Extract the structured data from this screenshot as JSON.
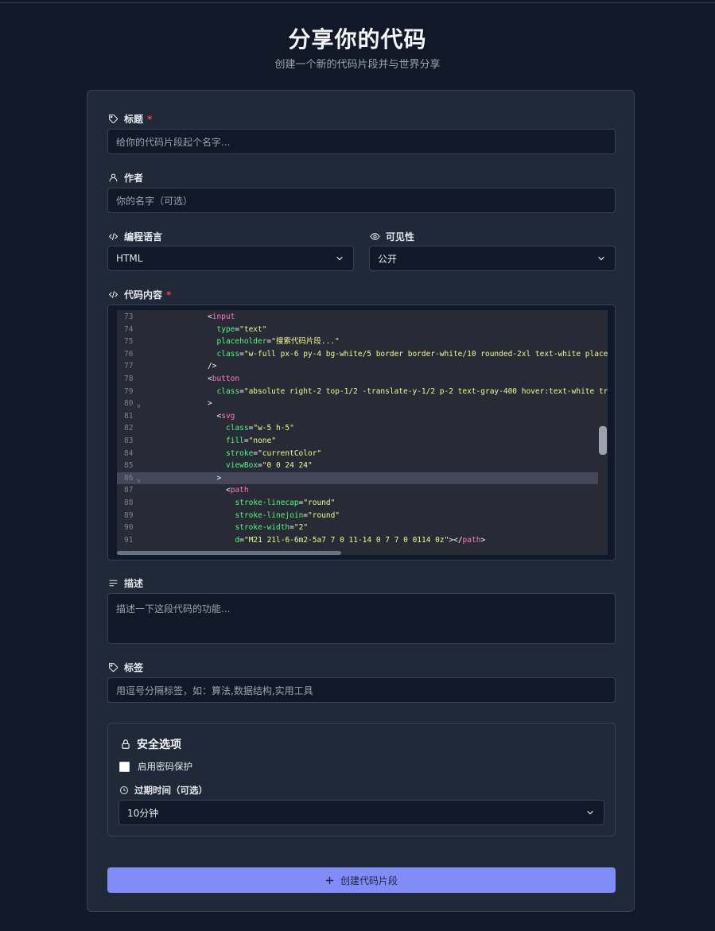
{
  "header": {
    "title": "分享你的代码",
    "subtitle": "创建一个新的代码片段并与世界分享"
  },
  "form": {
    "title_label": "标题",
    "required_mark": "*",
    "title_placeholder": "给你的代码片段起个名字...",
    "author_label": "作者",
    "author_placeholder": "你的名字（可选）",
    "language_label": "编程语言",
    "language_value": "HTML",
    "visibility_label": "可见性",
    "visibility_value": "公开",
    "code_label": "代码内容",
    "description_label": "描述",
    "description_placeholder": "描述一下这段代码的功能...",
    "tags_label": "标签",
    "tags_placeholder": "用逗号分隔标签，如：算法,数据结构,实用工具",
    "submit_label": "创建代码片段"
  },
  "security": {
    "title": "安全选项",
    "password_label": "启用密码保护",
    "password_checked": false,
    "expire_label": "过期时间（可选）",
    "expire_value": "10分钟"
  },
  "code_lines": [
    {
      "n": "73",
      "indent": 0,
      "segs": [
        [
          "punc",
          "<"
        ],
        [
          "tag",
          "input"
        ]
      ]
    },
    {
      "n": "74",
      "indent": 1,
      "segs": [
        [
          "attr",
          "type"
        ],
        [
          "punc",
          "="
        ],
        [
          "str",
          "\"text\""
        ]
      ]
    },
    {
      "n": "75",
      "indent": 1,
      "segs": [
        [
          "attr",
          "placeholder"
        ],
        [
          "punc",
          "="
        ],
        [
          "str",
          "\"搜索代码片段...\""
        ]
      ]
    },
    {
      "n": "76",
      "indent": 1,
      "segs": [
        [
          "attr",
          "class"
        ],
        [
          "punc",
          "="
        ],
        [
          "str",
          "\"w-full px-6 py-4 bg-white/5 border border-white/10 rounded-2xl text-white place"
        ]
      ]
    },
    {
      "n": "77",
      "indent": 0,
      "segs": [
        [
          "punc",
          "/>"
        ]
      ]
    },
    {
      "n": "78",
      "indent": 0,
      "segs": [
        [
          "punc",
          "<"
        ],
        [
          "tag",
          "button"
        ]
      ]
    },
    {
      "n": "79",
      "indent": 1,
      "segs": [
        [
          "attr",
          "class"
        ],
        [
          "punc",
          "="
        ],
        [
          "str",
          "\"absolute right-2 top-1/2 -translate-y-1/2 p-2 text-gray-400 hover:text-white tr"
        ]
      ]
    },
    {
      "n": "80",
      "fold": "v",
      "indent": 0,
      "segs": [
        [
          "punc",
          ">"
        ]
      ]
    },
    {
      "n": "81",
      "indent": 1,
      "segs": [
        [
          "punc",
          "<"
        ],
        [
          "tag",
          "svg"
        ]
      ]
    },
    {
      "n": "82",
      "indent": 2,
      "segs": [
        [
          "attr",
          "class"
        ],
        [
          "punc",
          "="
        ],
        [
          "str",
          "\"w-5 h-5\""
        ]
      ]
    },
    {
      "n": "83",
      "indent": 2,
      "segs": [
        [
          "attr",
          "fill"
        ],
        [
          "punc",
          "="
        ],
        [
          "str",
          "\"none\""
        ]
      ]
    },
    {
      "n": "84",
      "indent": 2,
      "segs": [
        [
          "attr",
          "stroke"
        ],
        [
          "punc",
          "="
        ],
        [
          "str",
          "\"currentColor\""
        ]
      ]
    },
    {
      "n": "85",
      "indent": 2,
      "segs": [
        [
          "attr",
          "viewBox"
        ],
        [
          "punc",
          "="
        ],
        [
          "str",
          "\"0 0 24 24\""
        ]
      ]
    },
    {
      "n": "86",
      "fold": "v",
      "active": true,
      "indent": 1,
      "segs": [
        [
          "punc",
          ">"
        ]
      ]
    },
    {
      "n": "87",
      "indent": 2,
      "segs": [
        [
          "punc",
          "<"
        ],
        [
          "tag",
          "path"
        ]
      ]
    },
    {
      "n": "88",
      "indent": 3,
      "segs": [
        [
          "attr",
          "stroke-linecap"
        ],
        [
          "punc",
          "="
        ],
        [
          "str",
          "\"round\""
        ]
      ]
    },
    {
      "n": "89",
      "indent": 3,
      "segs": [
        [
          "attr",
          "stroke-linejoin"
        ],
        [
          "punc",
          "="
        ],
        [
          "str",
          "\"round\""
        ]
      ]
    },
    {
      "n": "90",
      "indent": 3,
      "segs": [
        [
          "attr",
          "stroke-width"
        ],
        [
          "punc",
          "="
        ],
        [
          "str",
          "\"2\""
        ]
      ]
    },
    {
      "n": "91",
      "indent": 3,
      "segs": [
        [
          "attr",
          "d"
        ],
        [
          "punc",
          "="
        ],
        [
          "str",
          "\"M21 21l-6-6m2-5a7 7 0 11-14 0 7 7 0 0114 0z\""
        ],
        [
          "punc",
          ">"
        ],
        [
          "punc",
          "</"
        ],
        [
          "tag",
          "path"
        ],
        [
          "punc",
          ">"
        ]
      ]
    }
  ]
}
